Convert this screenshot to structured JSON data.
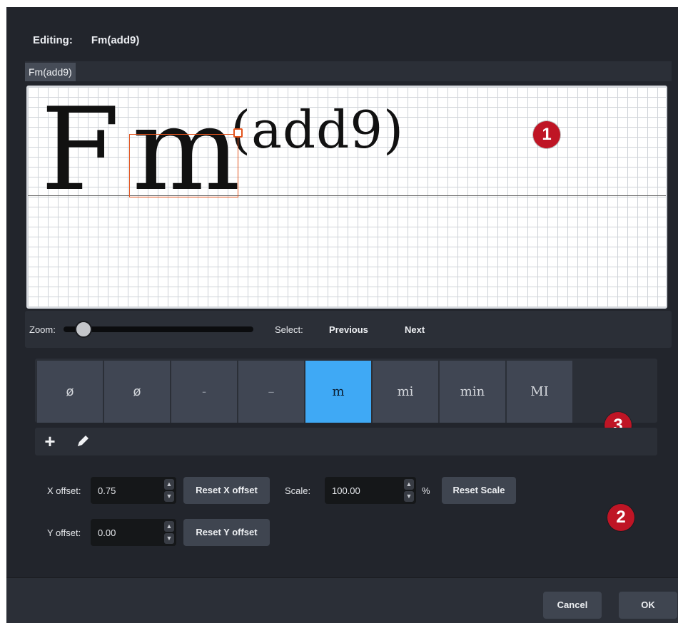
{
  "header": {
    "editing_label": "Editing:",
    "editing_value": "Fm(add9)"
  },
  "tabs": [
    {
      "label": "Fm(add9)"
    }
  ],
  "canvas": {
    "root": "F",
    "quality": "m",
    "extension": "(add9)"
  },
  "callouts": [
    "1",
    "3",
    "2"
  ],
  "zoom": {
    "label": "Zoom:",
    "value_fraction": 0.15
  },
  "select": {
    "label": "Select:",
    "previous": "Previous",
    "next": "Next"
  },
  "suffixes": [
    {
      "label": "ø",
      "style": "sans"
    },
    {
      "label": "ø",
      "style": "sans"
    },
    {
      "label": "-",
      "style": "dim"
    },
    {
      "label": "–",
      "style": "dim"
    },
    {
      "label": "m",
      "style": "active"
    },
    {
      "label": "mi",
      "style": "serif"
    },
    {
      "label": "min",
      "style": "serif"
    },
    {
      "label": "MI",
      "style": "serif"
    }
  ],
  "action_icons": [
    {
      "icon": "plus-icon"
    },
    {
      "icon": "pencil-icon"
    }
  ],
  "offsets": {
    "x_label": "X offset:",
    "x_value": "0.75",
    "reset_x": "Reset X offset",
    "y_label": "Y offset:",
    "y_value": "0.00",
    "reset_y": "Reset Y offset",
    "scale_label": "Scale:",
    "scale_value": "100.00",
    "scale_unit": "%",
    "reset_scale": "Reset Scale"
  },
  "footer": {
    "cancel": "Cancel",
    "ok": "OK"
  },
  "colors": {
    "accent": "#3fa9f5",
    "callout": "#bf1525",
    "selection": "#e2531c",
    "background": "#22252c"
  }
}
